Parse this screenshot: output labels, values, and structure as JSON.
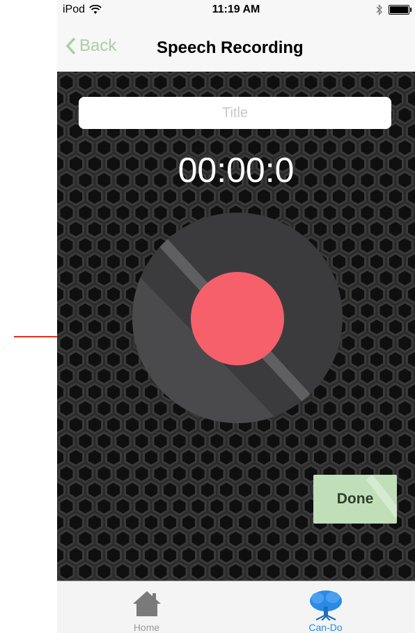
{
  "status_bar": {
    "carrier": "iPod",
    "time": "11:19 AM",
    "wifi_icon": "wifi-icon",
    "bluetooth_icon": "bluetooth-icon",
    "battery_icon": "battery-icon"
  },
  "nav": {
    "back_label": "Back",
    "title": "Speech Recording"
  },
  "recorder": {
    "title_placeholder": "Title",
    "title_value": "",
    "timer": "00:00:0",
    "done_label": "Done"
  },
  "tabs": [
    {
      "label": "Home",
      "icon": "home-icon",
      "selected": false
    },
    {
      "label": "Can-Do",
      "icon": "tree-icon",
      "selected": true
    }
  ],
  "colors": {
    "accent_green": "#a9cfa3",
    "record_red": "#f6606a",
    "tab_selected": "#2b8ae6",
    "annotation_arrow": "#e0301e"
  }
}
